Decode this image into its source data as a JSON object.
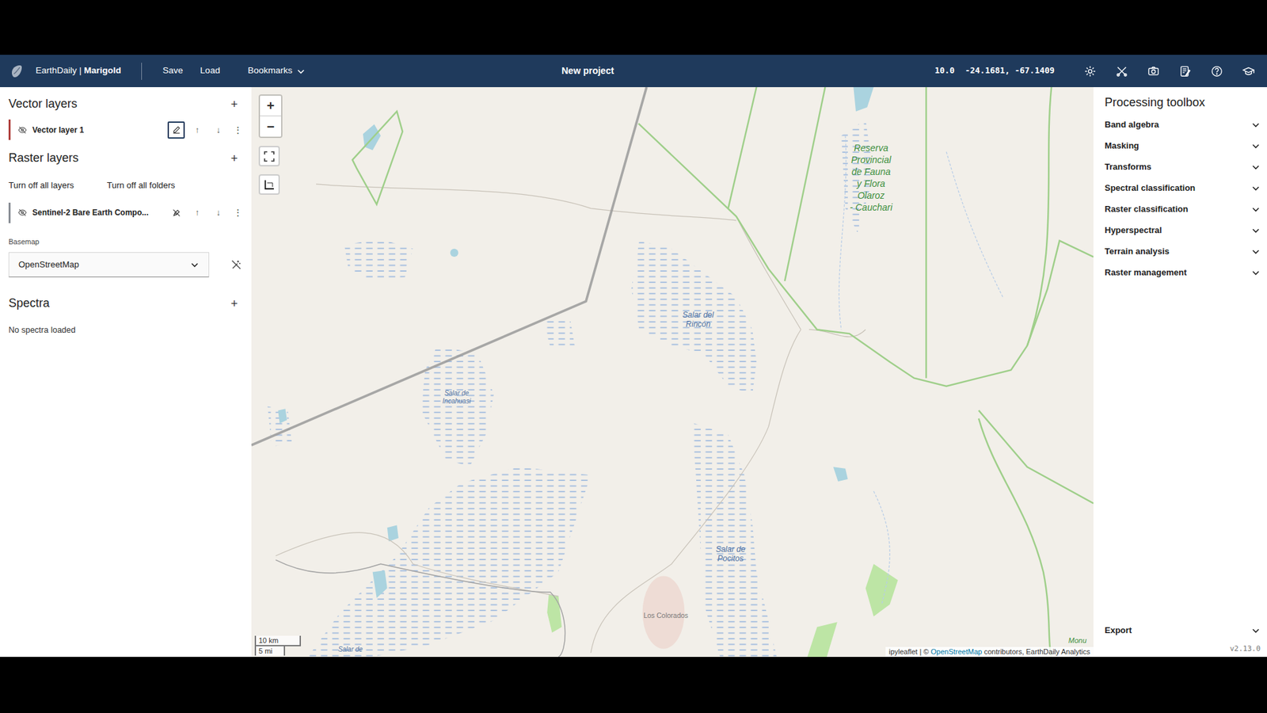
{
  "header": {
    "brand": "EarthDaily",
    "separator": "|",
    "product": "Marigold",
    "menu": [
      "Save",
      "Load"
    ],
    "bookmarks": {
      "label": "Bookmarks",
      "expanded": false
    },
    "title": "New project",
    "zoom": "10.0",
    "coordinates": "-24.1681, -67.1409"
  },
  "vector_layers": {
    "title": "Vector layers",
    "add": "+",
    "layers": [
      {
        "name": "Vector layer 1",
        "visible": false,
        "color": "#b0413e",
        "edit_highlighted": true
      }
    ]
  },
  "layer_controls": {
    "up": "↑",
    "down": "↓",
    "more": "⋮"
  },
  "raster_layers": {
    "title": "Raster layers",
    "add": "+",
    "actions": [
      "Turn off all layers",
      "Turn off all folders"
    ],
    "layers": [
      {
        "name": "Sentinel-2 Bare Earth Compo...",
        "visible": false,
        "color": "#8a8f96",
        "edit_highlighted": false
      }
    ]
  },
  "basemap": {
    "label": "Basemap",
    "value": "OpenStreetMap"
  },
  "spectra": {
    "title": "Spectra",
    "add": "+",
    "empty": "No spectra loaded"
  },
  "map": {
    "zoom_in": "+",
    "zoom_out": "−",
    "labels": [
      {
        "lines": [
          "Reserva",
          "Provincial",
          "de Fauna",
          "y Flora",
          "Olaroz",
          "- Cauchari"
        ],
        "kind": "protected"
      },
      {
        "lines": [
          "Salar del",
          "Rincón"
        ],
        "kind": "salt"
      },
      {
        "lines": [
          "Salar de",
          "Incahuasi"
        ],
        "kind": "salt-small"
      },
      {
        "lines": [
          "Salar de",
          "Pocitos"
        ],
        "kind": "salt"
      },
      {
        "lines": [
          "Los Colorados"
        ],
        "kind": "place"
      },
      {
        "lines": [
          "Monu"
        ],
        "kind": "protected-small"
      },
      {
        "lines": [
          "Salar de"
        ],
        "kind": "salt-small"
      }
    ],
    "scale": [
      "10 km",
      "5 mi"
    ],
    "attribution": [
      {
        "text": "ipyleaflet | © ",
        "link": false
      },
      {
        "text": "OpenStreetMap",
        "link": true
      },
      {
        "text": " contributors, EarthDaily Analytics",
        "link": false
      }
    ]
  },
  "toolbox": {
    "title": "Processing toolbox",
    "sections": [
      {
        "label": "Band algebra",
        "expanded": false
      },
      {
        "label": "Masking",
        "expanded": false
      },
      {
        "label": "Transforms",
        "expanded": false
      },
      {
        "label": "Spectral classification",
        "expanded": false
      },
      {
        "label": "Raster classification",
        "expanded": false
      },
      {
        "label": "Hyperspectral",
        "expanded": false
      },
      {
        "label": "Terrain analysis",
        "expanded": false
      },
      {
        "label": "Raster management",
        "expanded": false
      }
    ],
    "export": {
      "label": "Export",
      "expanded": false
    },
    "version": "v2.13.0"
  }
}
